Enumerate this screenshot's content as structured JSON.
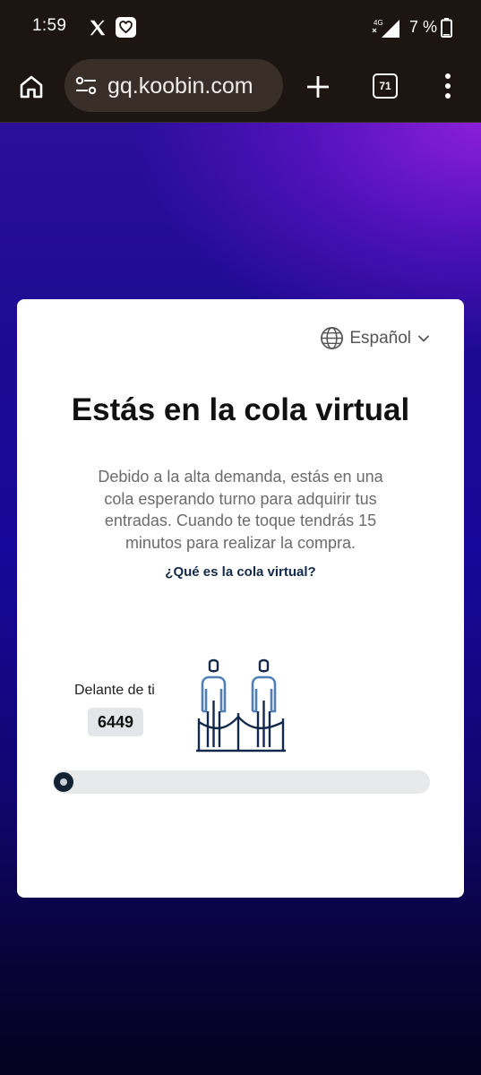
{
  "status_bar": {
    "time": "1:59",
    "network": "4G",
    "battery": "7 %"
  },
  "browser": {
    "url": "gq.koobin.com",
    "tab_count": "71",
    "icons": [
      "home-icon",
      "site-settings-icon",
      "plus-icon",
      "tab-switcher-icon",
      "more-icon"
    ]
  },
  "page": {
    "language": "Español",
    "title": "Estás en la cola virtual",
    "description": "Debido a la alta demanda, estás en una cola esperando turno para adquirir tus entradas. Cuando te toque tendrás 15 minutos para realizar la compra.",
    "faq_link": "¿Qué es la cola virtual?",
    "ahead_label": "Delante de ti",
    "ahead_count": "6449",
    "progress_fraction": 0.0
  },
  "colors": {
    "card_bg": "#ffffff",
    "accent_dark": "#13294b",
    "illustration_blue": "#4e7fb8",
    "page_gradient_top": "#2a0f9a",
    "page_gradient_glow": "#8a1fd8"
  }
}
